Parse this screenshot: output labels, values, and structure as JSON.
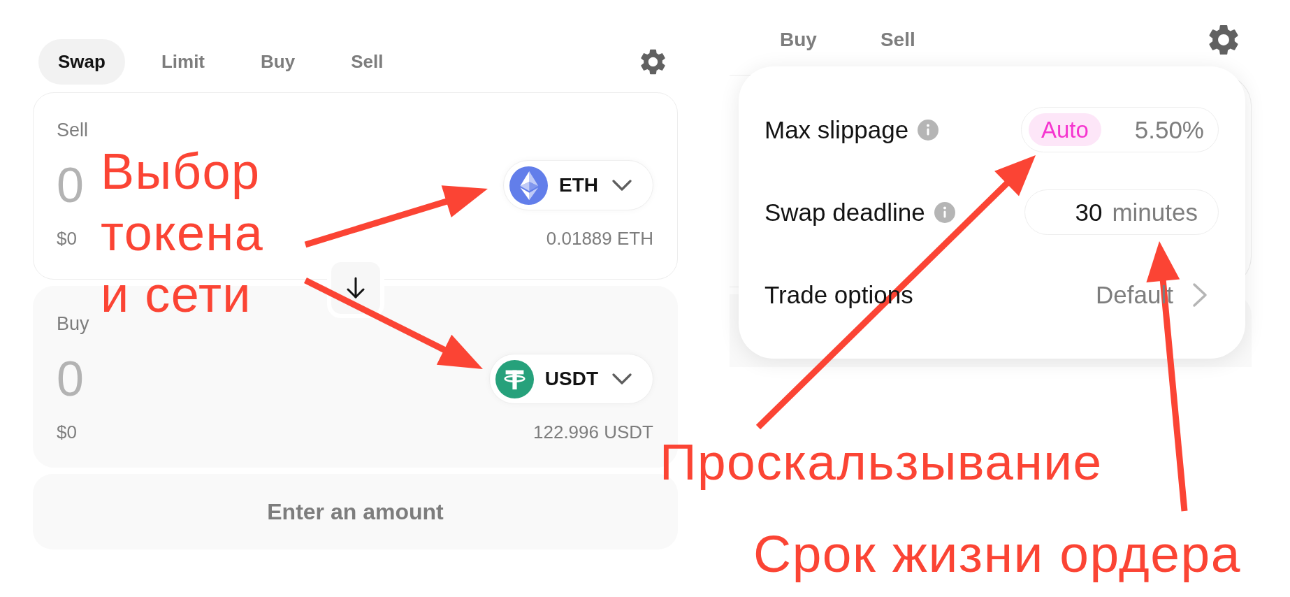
{
  "swap_panel": {
    "tabs": [
      {
        "label": "Swap",
        "selected": true
      },
      {
        "label": "Limit",
        "selected": false
      },
      {
        "label": "Buy",
        "selected": false
      },
      {
        "label": "Sell",
        "selected": false
      }
    ],
    "sell": {
      "label": "Sell",
      "amount": {
        "placeholder": "0"
      },
      "fiat_value": "$0",
      "token": {
        "symbol": "ETH",
        "kind": "eth"
      },
      "balance": "0.01889 ETH"
    },
    "buy": {
      "label": "Buy",
      "amount": {
        "placeholder": "0"
      },
      "fiat_value": "$0",
      "token": {
        "symbol": "USDT",
        "kind": "usdt"
      },
      "balance": "122.996 USDT"
    },
    "action_button": {
      "label": "Enter an amount",
      "disabled": true
    }
  },
  "settings_panel": {
    "tabs": [
      {
        "label": "Buy",
        "selected": false
      },
      {
        "label": "Sell",
        "selected": false
      }
    ],
    "rows": [
      {
        "kind": "slippage",
        "label": "Max slippage",
        "info": true,
        "badge": "Auto",
        "value": "5.50%"
      },
      {
        "kind": "deadline",
        "label": "Swap deadline",
        "info": true,
        "value": "30",
        "unit": "minutes"
      },
      {
        "kind": "link",
        "label": "Trade options",
        "info": false,
        "value": "Default"
      }
    ]
  },
  "annotations": [
    {
      "text": "Выбор токена и сети"
    },
    {
      "text": "Проскальзывание"
    },
    {
      "text": "Срок жизни ордера"
    }
  ]
}
